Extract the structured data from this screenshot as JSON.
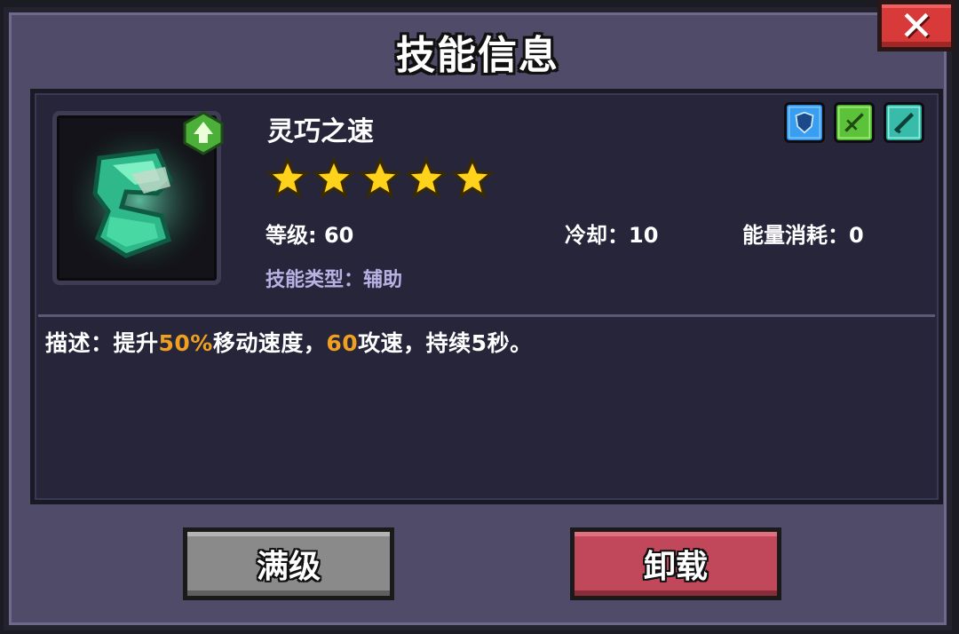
{
  "dialog": {
    "title": "技能信息",
    "close_label": "✕"
  },
  "skill": {
    "name": "灵巧之速",
    "stars": 5,
    "level_label": "等级: 60",
    "cooldown_label": "冷却：10",
    "energy_label": "能量消耗：0",
    "type_label": "技能类型：辅助",
    "type_icons": [
      "shield-icon",
      "green-sword-icon",
      "teal-sword-icon"
    ],
    "icon": "boots-icon",
    "badge_icon": "upgrade-arrow-icon"
  },
  "description": {
    "prefix": "描述：提升",
    "value1": "50%",
    "mid": "移动速度，",
    "value2": "60",
    "suffix": "攻速，持续5秒。",
    "highlight_color": "#f0a020"
  },
  "buttons": {
    "max_label": "满级",
    "unload_label": "卸载"
  },
  "colors": {
    "panel_bg": "#4f4b68",
    "inner_bg": "#26253a",
    "unload_button": "#c0485a",
    "max_button": "#8a8a8a",
    "close_button": "#d83a3a"
  }
}
